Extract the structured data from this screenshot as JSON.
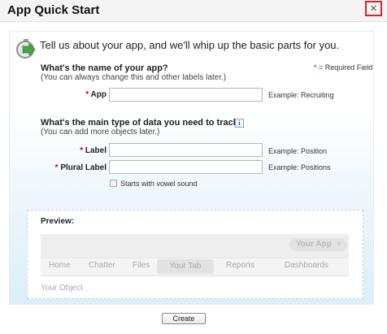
{
  "dialog": {
    "title": "App Quick Start",
    "close_label": "×"
  },
  "intro": {
    "icon": "stopwatch-arrow-icon",
    "text": "Tell us about your app, and we'll whip up the basic parts for you."
  },
  "required_legend": {
    "star": "*",
    "text": " = Required Field"
  },
  "app_section": {
    "question": "What's the name of your app?",
    "hint": "(You can always change this and other labels later.)",
    "field": {
      "star": "*",
      "label": "App",
      "value": "",
      "example": "Example: Recruiting"
    }
  },
  "data_section": {
    "question": "What's the main type of data you need to track?",
    "info_icon": "i",
    "hint": "(You can add more objects later.)",
    "label_field": {
      "star": "*",
      "label": "Label",
      "value": "",
      "example": "Example: Position"
    },
    "plural_field": {
      "star": "*",
      "label": "Plural Label",
      "value": "",
      "example": "Example: Positions"
    },
    "vowel_checkbox": {
      "checked": false,
      "label": "Starts with vowel sound"
    }
  },
  "preview": {
    "title": "Preview:",
    "app_menu": "Your App",
    "app_menu_chevron": "∨",
    "tabs": [
      "Home",
      "Chatter",
      "Files",
      "Your Tab",
      "Reports",
      "Dashboards"
    ],
    "active_tab": "Your Tab",
    "object_label": "Your Object"
  },
  "footer": {
    "create_label": "Create"
  },
  "colors": {
    "close_border": "#d9232e",
    "required_star": "#c00000",
    "panel_gradient_bottom": "#dbeef8"
  }
}
